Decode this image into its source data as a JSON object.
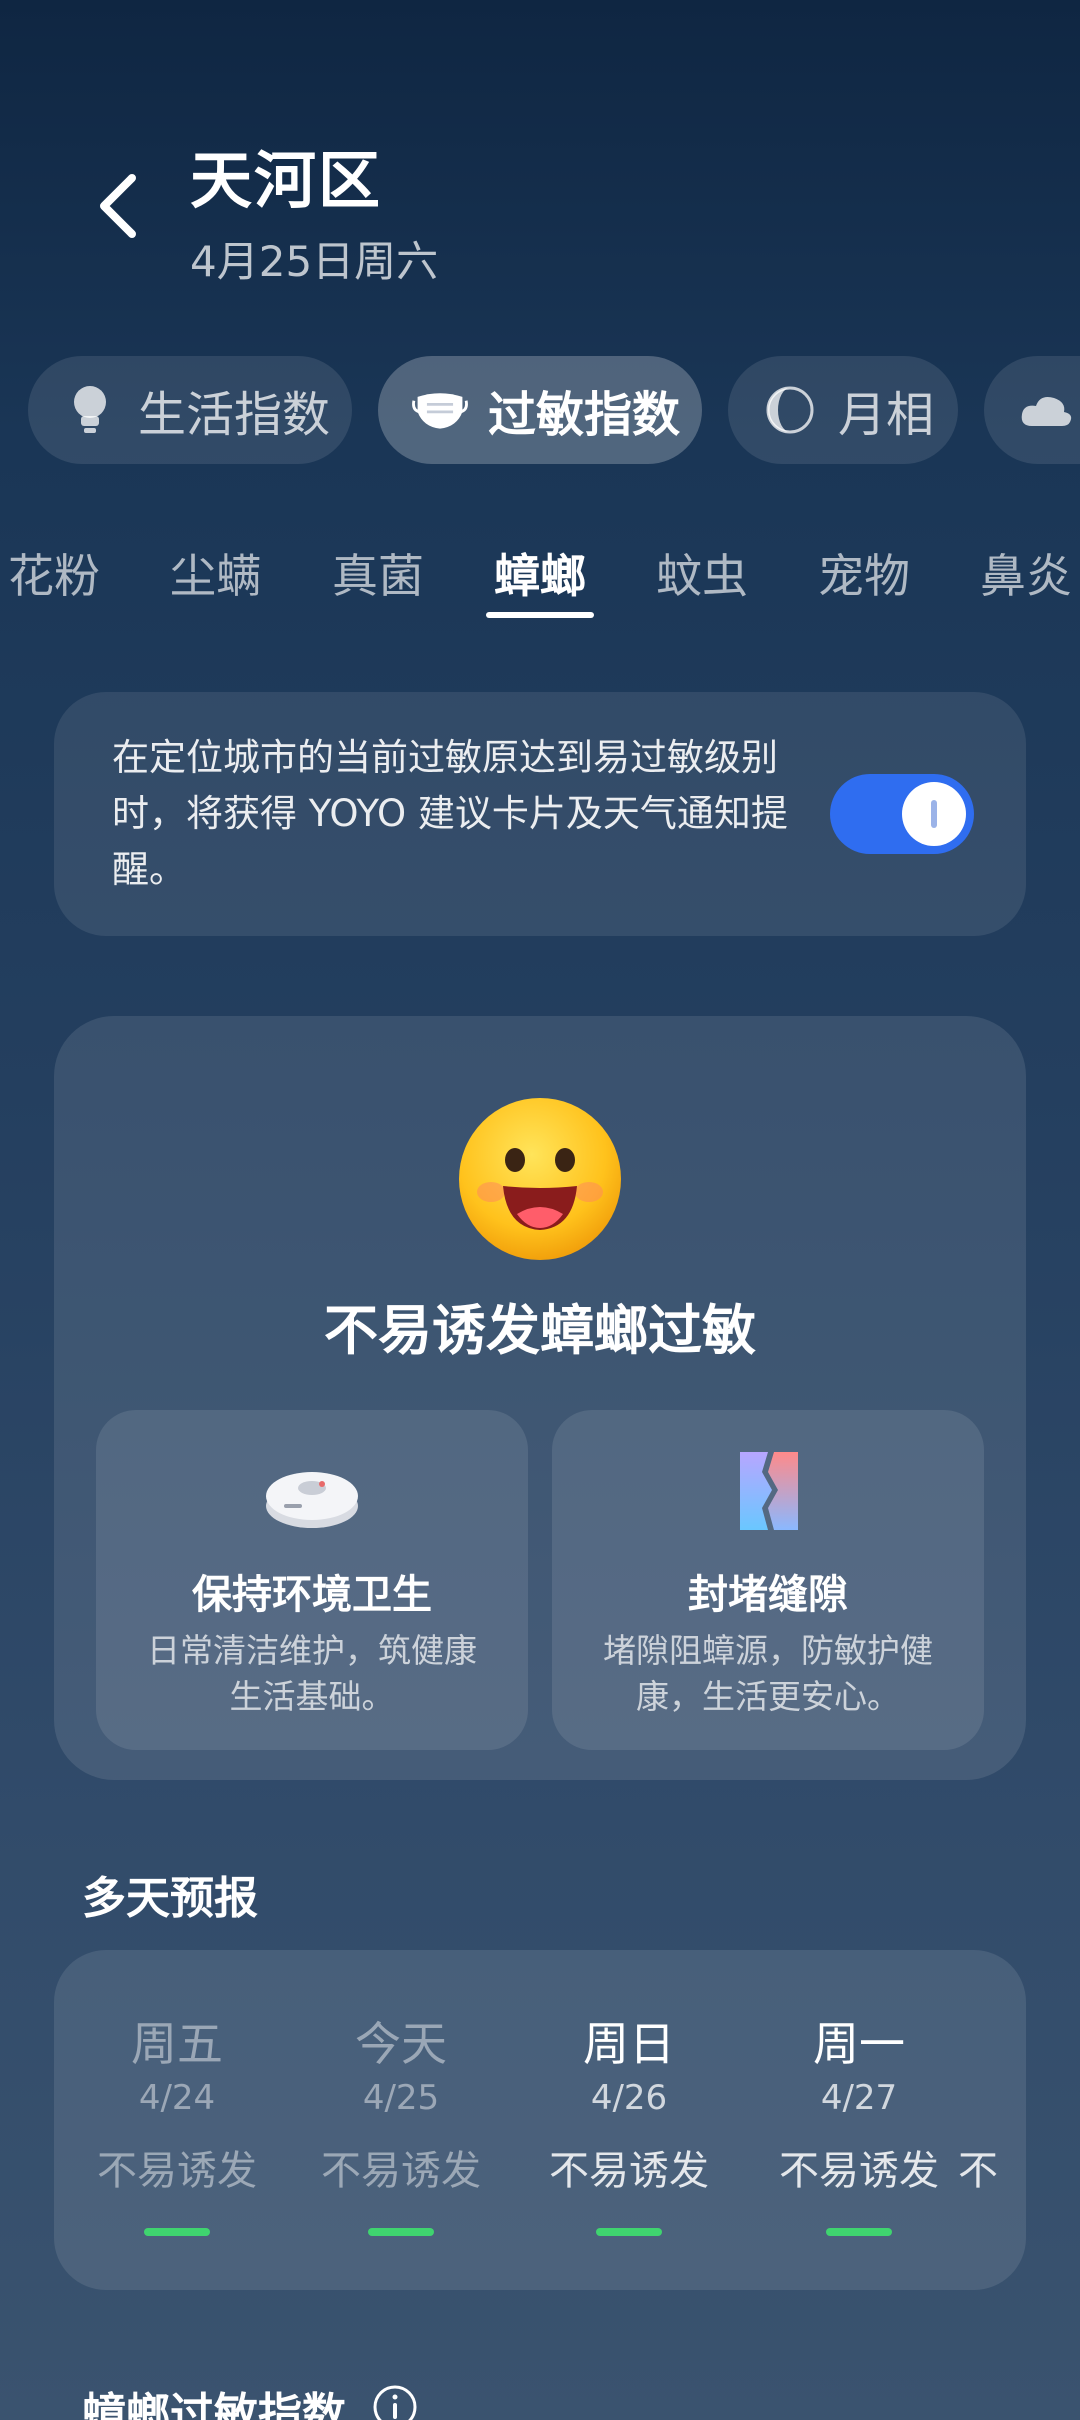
{
  "header": {
    "title": "天河区",
    "date": "4月25日周六"
  },
  "categories": [
    {
      "label": "生活指数",
      "icon": "lightbulb-icon"
    },
    {
      "label": "过敏指数",
      "icon": "mask-icon",
      "active": true
    },
    {
      "label": "月相",
      "icon": "moon-icon"
    },
    {
      "label": "",
      "icon": "cloud-icon"
    }
  ],
  "allergen_tabs": [
    {
      "label": "花粉"
    },
    {
      "label": "尘螨"
    },
    {
      "label": "真菌"
    },
    {
      "label": "蟑螂",
      "active": true
    },
    {
      "label": "蚊虫"
    },
    {
      "label": "宠物"
    },
    {
      "label": "鼻炎"
    }
  ],
  "notify": {
    "text": "在定位城市的当前过敏原达到易过敏级别时，将获得 YOYO 建议卡片及天气通知提醒。",
    "enabled": true
  },
  "status": {
    "text": "不易诱发蟑螂过敏",
    "icon": "smile-emoji-icon"
  },
  "tips": [
    {
      "title": "保持环境卫生",
      "desc": "日常清洁维护，筑健康生活基础。",
      "icon": "robot-vacuum-icon"
    },
    {
      "title": "封堵缝隙",
      "desc": "堵隙阻蟑源，防敏护健康，生活更安心。",
      "icon": "crack-seal-icon"
    }
  ],
  "forecast": {
    "title": "多天预报",
    "days": [
      {
        "name": "周五",
        "date": "4/24",
        "level": "不易诱发",
        "state": "past"
      },
      {
        "name": "今天",
        "date": "4/25",
        "level": "不易诱发",
        "state": "past"
      },
      {
        "name": "周日",
        "date": "4/26",
        "level": "不易诱发",
        "state": "future"
      },
      {
        "name": "周一",
        "date": "4/27",
        "level": "不易诱发",
        "state": "future"
      },
      {
        "name": "",
        "date": "",
        "level": "不",
        "state": "future"
      }
    ],
    "level_color": "#3fd46f"
  },
  "bottom_section": {
    "title": "蟑螂过敏指数"
  },
  "colors": {
    "accent": "#2f6df0",
    "good": "#3fd46f"
  }
}
